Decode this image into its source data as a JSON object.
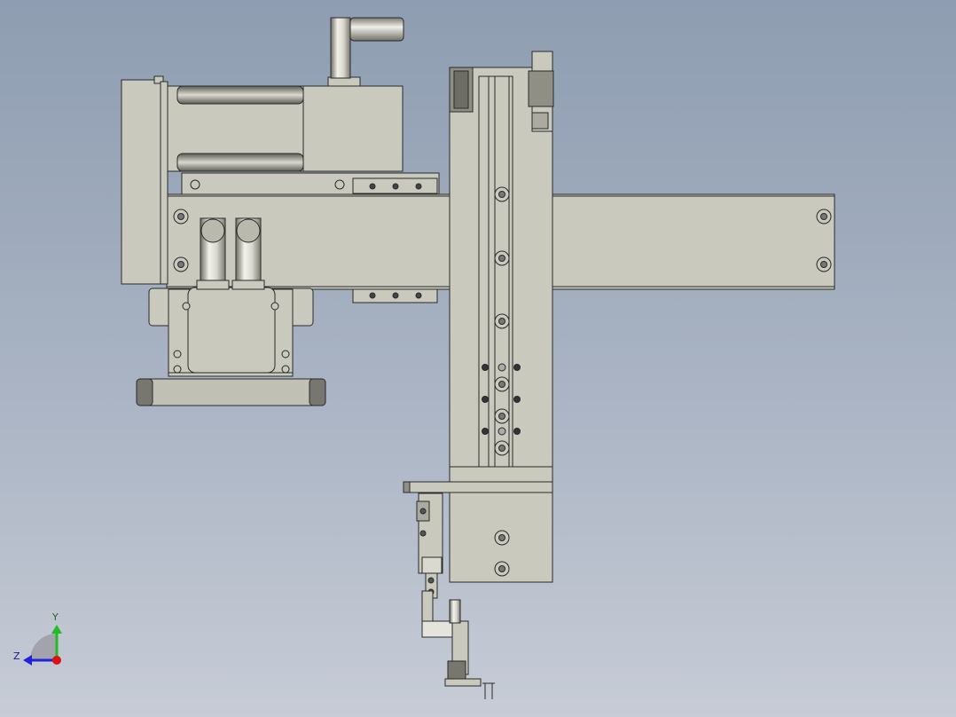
{
  "triad": {
    "y_label": "Y",
    "z_label": "Z",
    "y_color": "#22bb22",
    "z_color": "#2222dd",
    "x_color": "#dd1111"
  },
  "colors": {
    "background_top": "#8e9db1",
    "background_bottom": "#c7ccd6",
    "part_fill": "#c9c9bd",
    "part_dark": "#8f8f85",
    "edge": "#2a2a2a"
  },
  "icons": [
    "view-triad-icon"
  ]
}
